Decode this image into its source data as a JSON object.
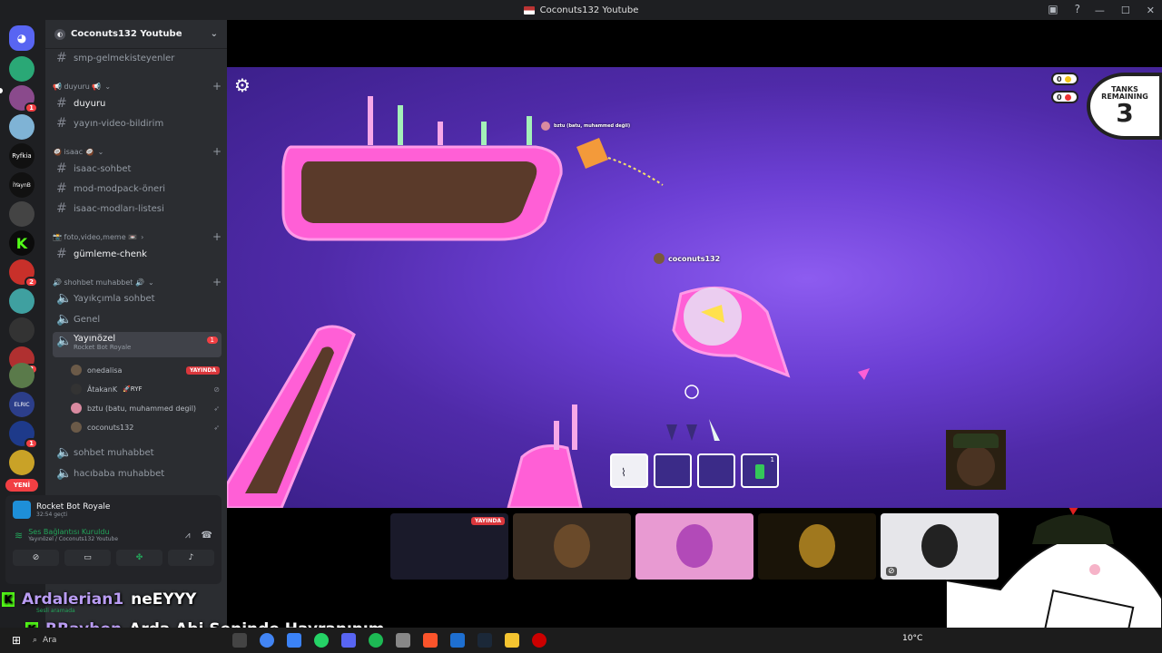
{
  "window": {
    "title": "Coconuts132 Youtube"
  },
  "guild": {
    "name": "Coconuts132 Youtube"
  },
  "servers": {
    "badges": [
      "1",
      "2",
      "2",
      "2",
      "1"
    ],
    "new_label": "YENİ"
  },
  "channels": {
    "ch1": "smp-gelmekisteyenler",
    "cat1": "📢 duyuru 📢",
    "ch2": "duyuru",
    "ch3": "yayın-video-bildirim",
    "cat2": "🥥 isaac 🥥",
    "ch4": "isaac-sohbet",
    "ch5": "mod-modpack-öneri",
    "ch6": "isaac-modları-listesi",
    "cat3": "📸 foto,video,meme 📼",
    "ch7": "gümleme-chenk",
    "cat4": "🔊 shohbet muhabbet 🔊",
    "ch8": "Yayıkçımla sohbet",
    "ch9": "Genel",
    "ch10": "Yayınözel",
    "ch10_sub": "Rocket Bot Royale",
    "ch10_badge": "1",
    "ch11": "sohbet muhabbet",
    "ch12": "hacıbaba muhabbet"
  },
  "voice_users": [
    {
      "name": "onedalisa",
      "live": "YAYINDA"
    },
    {
      "name": "ÂtakanK",
      "tag": "🚀RYF"
    },
    {
      "name": "bztu (batu, muhammed degil)"
    },
    {
      "name": "coconuts132"
    }
  ],
  "panel": {
    "activity_title": "Rocket Bot Royale",
    "activity_time": "32:54 geçti",
    "voice_status": "Ses Bağlantısı Kuruldu",
    "voice_channel": "Yayınözel / Coconuts132 Youtube",
    "user_status": "Sesli aramada"
  },
  "game": {
    "player_name": "coconuts132",
    "enemy_name": "bztu (batu, muhammed değil)",
    "coins": "0",
    "kills": "0",
    "tanks_label": "TANKS REMAINING",
    "tanks_remaining": "3",
    "slot4_count": "1"
  },
  "streams": {
    "live_label": "YAYINDA"
  },
  "chat": [
    {
      "user": "Ardalerian1",
      "user_color": "#b99cf2",
      "message": "neEYYY"
    },
    {
      "user": "RRaybon",
      "user_color": "#b99cf2",
      "message": "Arda Abi Seninde Hayranınım"
    }
  ],
  "taskbar": {
    "search": "Ara",
    "weather": "10°C"
  },
  "colors": {
    "accent_pink": "#ff4fd8",
    "kick_green": "#53fc18",
    "live_red": "#da373c",
    "voice_green": "#23a55a"
  }
}
